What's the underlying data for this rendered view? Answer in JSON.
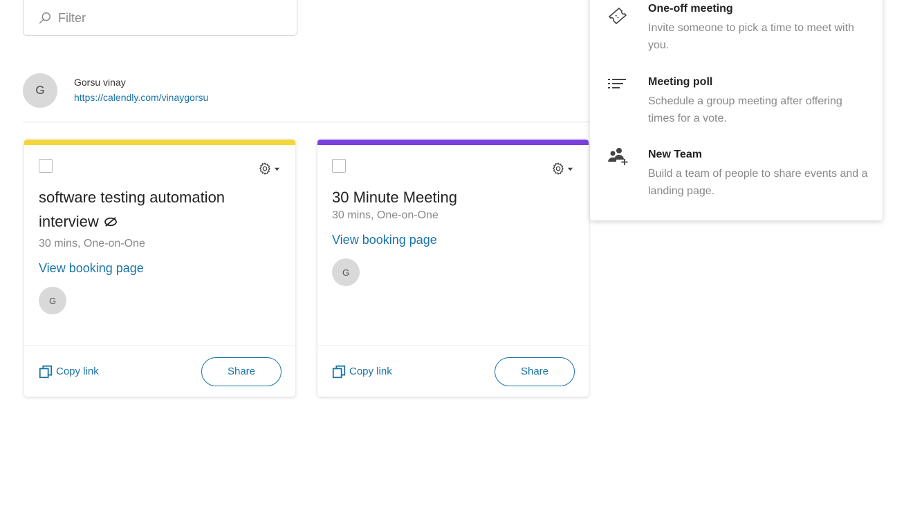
{
  "filter": {
    "placeholder": "Filter"
  },
  "user": {
    "initial": "G",
    "name": "Gorsu vinay",
    "link": "https://calendly.com/vinaygorsu"
  },
  "colors": {
    "card1_accent": "#f2d63a",
    "card2_accent": "#7b3fe0",
    "link": "#1a73a8"
  },
  "cards": [
    {
      "title": "software testing automation interview",
      "hidden_icon": "eye-slash-icon",
      "meta": "30 mins, One-on-One",
      "link_label": "View booking page",
      "host_initial": "G",
      "copy_label": "Copy link",
      "share_label": "Share"
    },
    {
      "title": "30 Minute Meeting",
      "meta": "30 mins, One-on-One",
      "link_label": "View booking page",
      "host_initial": "G",
      "copy_label": "Copy link",
      "share_label": "Share"
    }
  ],
  "dropdown": {
    "items": [
      {
        "title": "One-off meeting",
        "description": "Invite someone to pick a time to meet with you.",
        "icon": "ticket-icon"
      },
      {
        "title": "Meeting poll",
        "description": "Schedule a group meeting after offering times for a vote.",
        "icon": "poll-list-icon"
      },
      {
        "title": "New Team",
        "description": "Build a team of people to share events and a landing page.",
        "icon": "add-team-icon"
      }
    ]
  }
}
